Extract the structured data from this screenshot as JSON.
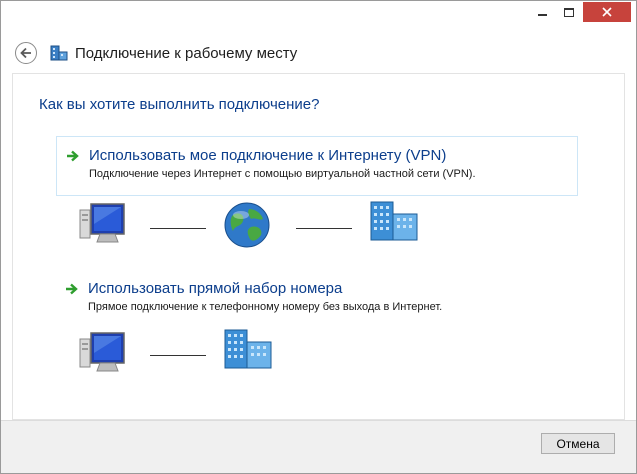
{
  "window": {
    "title": "Подключение к рабочему месту",
    "controls": [
      "minimize",
      "maximize",
      "close"
    ]
  },
  "header": {
    "back_icon": "back-arrow-icon",
    "app_icon": "network-building-icon",
    "title": "Подключение к рабочему месту"
  },
  "main": {
    "question": "Как вы хотите выполнить подключение?",
    "options": [
      {
        "icon": "green-arrow-icon",
        "title": "Использовать мое подключение к Интернету (VPN)",
        "description": "Подключение через Интернет с помощью виртуальной частной сети (VPN).",
        "diagram": [
          "computer-icon",
          "globe-icon",
          "server-building-icon"
        ]
      },
      {
        "icon": "green-arrow-icon",
        "title": "Использовать прямой набор номера",
        "description": "Прямое подключение к телефонному номеру без выхода в Интернет.",
        "diagram": [
          "computer-icon",
          "server-building-icon"
        ]
      }
    ]
  },
  "footer": {
    "cancel_label": "Отмена"
  },
  "colors": {
    "accent_text": "#0c3e8c",
    "close_button": "#c7433c",
    "footer_bg": "#f0f0f0",
    "option_border": "#cde6f7",
    "arrow_green": "#2e9e2e"
  }
}
